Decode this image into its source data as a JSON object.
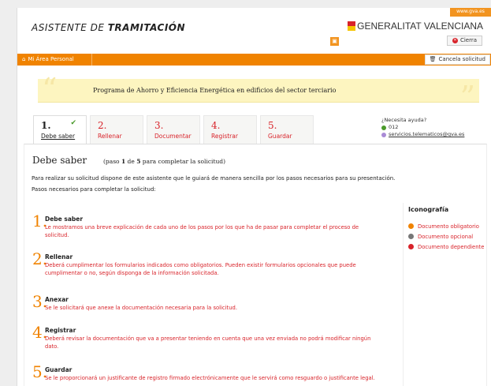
{
  "header": {
    "gva_tab": "www.gva.es",
    "app_title_prefix": "ASISTENTE DE ",
    "app_title_bold": "TRAMITACIÓN",
    "logo_text": "GENERALITAT VALENCIANA",
    "close_label": "Cierra"
  },
  "navbar": {
    "area_personal": "Mi Área Personal",
    "cancel_label": "Cancela solicitud"
  },
  "program": {
    "title": "Programa de Ahorro y Eficiencia Energética en edificios del sector terciario"
  },
  "steps": [
    {
      "num": "1.",
      "label": "Debe saber",
      "active": true,
      "done": true
    },
    {
      "num": "2.",
      "label": "Rellenar",
      "active": false
    },
    {
      "num": "3.",
      "label": "Documentar",
      "active": false
    },
    {
      "num": "4.",
      "label": "Registrar",
      "active": false
    },
    {
      "num": "5.",
      "label": "Guardar",
      "active": false
    }
  ],
  "help": {
    "question": "¿Necesita ayuda?",
    "phone": "012",
    "email": "servicios.telematicos@gva.es"
  },
  "content": {
    "title": "Debe saber",
    "paso_prefix": "(paso ",
    "paso_current": "1",
    "paso_de": " de ",
    "paso_total": "5",
    "paso_suffix": " para completar la solicitud)",
    "intro1": "Para realizar su solicitud dispone de este asistente que le guiará de manera sencilla por los pasos necesarios para su presentación.",
    "intro2": "Pasos necesarios para completar la solicitud:",
    "items": [
      {
        "num": "1.",
        "head": "Debe saber",
        "body": "Le mostramos una breve explicación de cada uno de los pasos por los que ha de pasar para completar el proceso de solicitud."
      },
      {
        "num": "2.",
        "head": "Rellenar",
        "body": "Deberá cumplimentar los formularios indicados como obligatorios. Pueden existir formularios opcionales que puede cumplimentar o no, según disponga de la información solicitada."
      },
      {
        "num": "3.",
        "head": "Anexar",
        "body": "Se le solicitará que anexe la documentación necesaria para la solicitud."
      },
      {
        "num": "4.",
        "head": "Registrar",
        "body": "Deberá revisar la documentación que va a presentar teniendo en cuenta que una vez enviada no podrá modificar ningún dato."
      },
      {
        "num": "5.",
        "head": "Guardar",
        "body": "Se le proporcionará un justificante de registro firmado electrónicamente que le servirá como resguardo o justificante legal."
      }
    ]
  },
  "iconografia": {
    "title": "Iconografía",
    "items": [
      {
        "label": "Documento obligatorio",
        "icon": "orange-circle-icon",
        "color": "#f08300"
      },
      {
        "label": "Documento opcional",
        "icon": "gray-trophy-icon",
        "color": "#777777"
      },
      {
        "label": "Documento dependiente",
        "icon": "red-circle-icon",
        "color": "#d8232a"
      }
    ]
  },
  "colors": {
    "accent_orange": "#f08300",
    "link_red": "#d8232a",
    "banner_yellow": "#fdf5c0"
  }
}
